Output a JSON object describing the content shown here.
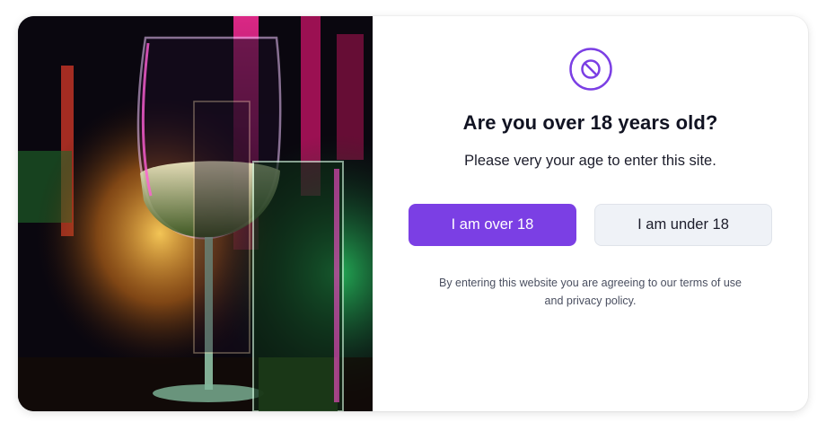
{
  "dialog": {
    "title": "Are you over 18 years old?",
    "subtitle": "Please very your age to enter this site.",
    "over_button_label": "I am over 18",
    "under_button_label": "I am under 18",
    "terms_line1": "By entering this website you are agreeing to our terms of use",
    "terms_line2": "and privacy policy.",
    "icon": "ban-icon",
    "photo": "wine-glass-photo"
  },
  "colors": {
    "accent": "#7b3fe4",
    "secondary_button_bg": "#eff2f7",
    "title_text": "#111322",
    "muted_text": "#4a4f60"
  }
}
